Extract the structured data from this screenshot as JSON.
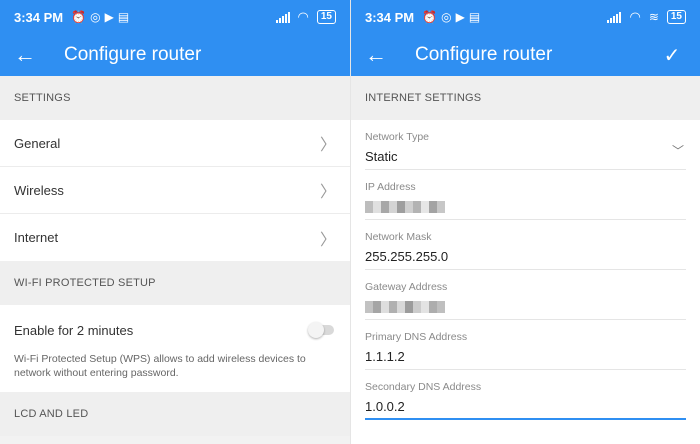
{
  "status": {
    "time": "3:34 PM",
    "battery": "15"
  },
  "left": {
    "title": "Configure router",
    "sections": {
      "settings": "SETTINGS",
      "wps": "WI-FI PROTECTED SETUP",
      "lcd": "LCD AND LED"
    },
    "items": [
      {
        "label": "General"
      },
      {
        "label": "Wireless"
      },
      {
        "label": "Internet"
      }
    ],
    "wps_toggle_label": "Enable for 2 minutes",
    "wps_toggle_on": false,
    "wps_desc": "Wi-Fi Protected Setup (WPS) allows to add wireless devices to network without entering password."
  },
  "right": {
    "title": "Configure router",
    "section": "INTERNET SETTINGS",
    "fields": [
      {
        "label": "Network Type",
        "value": "Static"
      },
      {
        "label": "IP Address",
        "value": ""
      },
      {
        "label": "Network Mask",
        "value": "255.255.255.0"
      },
      {
        "label": "Gateway Address",
        "value": ""
      },
      {
        "label": "Primary DNS Address",
        "value": "1.1.1.2"
      },
      {
        "label": "Secondary DNS Address",
        "value": "1.0.0.2"
      }
    ]
  },
  "colors": {
    "accent": "#2f8ff2"
  },
  "icons": {
    "back": "back-arrow-icon",
    "confirm": "check-icon",
    "chevron": "chevron-right-icon",
    "dropdown": "chevron-down-icon"
  }
}
